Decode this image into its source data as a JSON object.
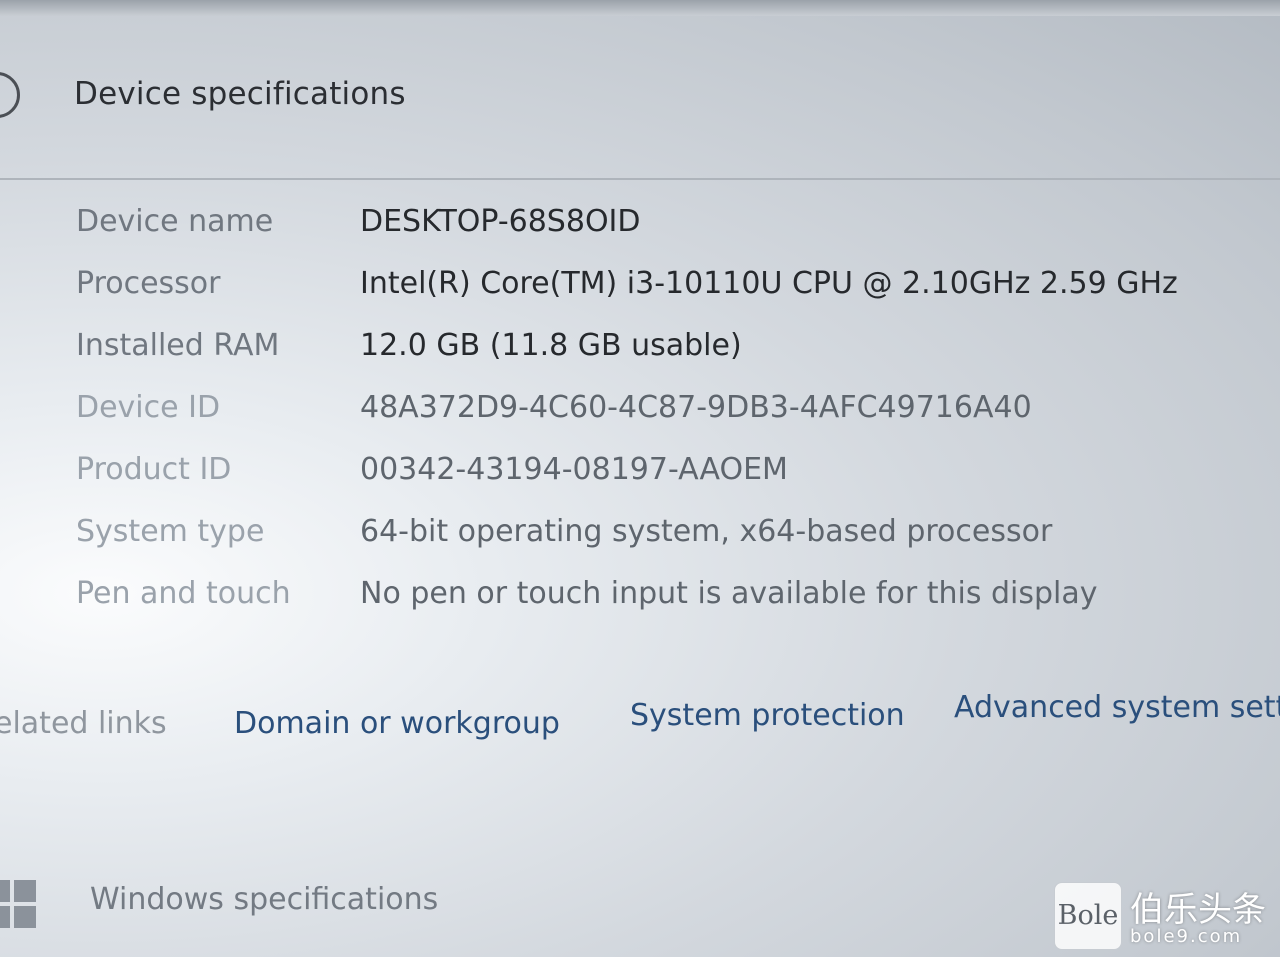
{
  "header": {
    "title": "Device specifications",
    "expand_icon": "chevron-circle-icon"
  },
  "specs": [
    {
      "label": "Device name",
      "value": "DESKTOP-68S8OID"
    },
    {
      "label": "Processor",
      "value": "Intel(R) Core(TM) i3-10110U CPU @ 2.10GHz   2.59 GHz"
    },
    {
      "label": "Installed RAM",
      "value": "12.0 GB (11.8 GB usable)"
    },
    {
      "label": "Device ID",
      "value": "48A372D9-4C60-4C87-9DB3-4AFC49716A40"
    },
    {
      "label": "Product ID",
      "value": "00342-43194-08197-AAOEM"
    },
    {
      "label": "System type",
      "value": "64-bit operating system, x64-based processor"
    },
    {
      "label": "Pen and touch",
      "value": "No pen or touch input is available for this display"
    }
  ],
  "related": {
    "label": "elated links",
    "links": [
      "Domain or workgroup",
      "System protection",
      "Advanced system settir"
    ]
  },
  "windows_section": {
    "title": "Windows specifications",
    "icon": "windows-logo-icon"
  },
  "watermark": {
    "logo": "Bole",
    "name": "伯乐头条",
    "url": "bole9.com"
  }
}
